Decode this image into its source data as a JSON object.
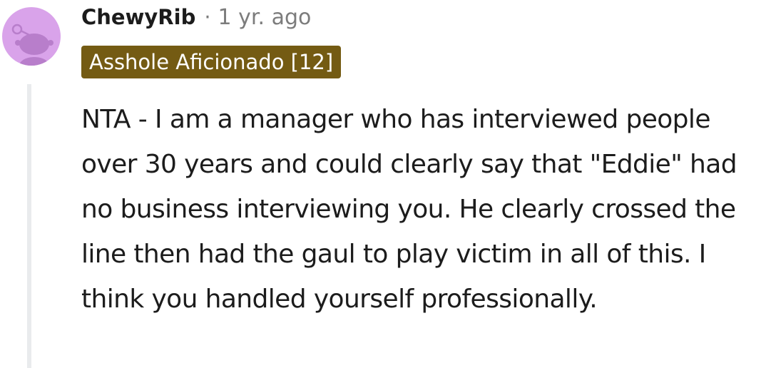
{
  "comment": {
    "avatar_icon": "reddit-snoo-avatar-icon",
    "avatar_color": "#d9a3ea",
    "username": "ChewyRib",
    "separator": "·",
    "timestamp": "1 yr. ago",
    "flair": {
      "text": "Asshole Aficionado [12]",
      "background": "#745b13"
    },
    "body": "NTA - I am a manager who has interviewed people over 30 years and could clearly say that \"Eddie\" had no business interviewing you. He clearly crossed the line then had the gaul to play victim in all of this. I think you handled yourself professionally."
  }
}
